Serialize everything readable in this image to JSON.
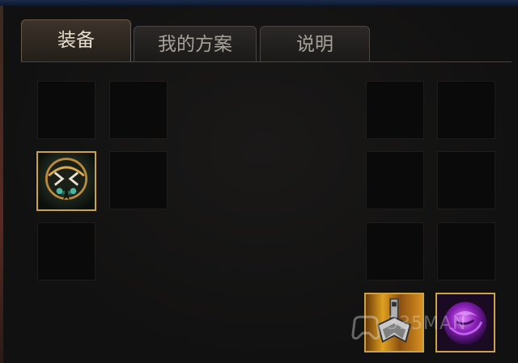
{
  "tabs": [
    {
      "label": "装备",
      "active": true
    },
    {
      "label": "我的方案",
      "active": false
    },
    {
      "label": "说明",
      "active": false
    }
  ],
  "left_grid": {
    "slots": [
      "empty",
      "empty",
      "guardian-helm-item",
      "empty",
      "empty"
    ]
  },
  "right_grid": {
    "slots": [
      "empty",
      "empty",
      "empty",
      "empty",
      "empty",
      "empty",
      "grappling-hook-item",
      "purple-orb-item"
    ]
  },
  "watermark": {
    "text": "335MAN"
  },
  "colors": {
    "background": "#141313",
    "slot": "#0a0a0a",
    "item_border": "#c9a24a",
    "tab_text": "#c8c2b6"
  }
}
